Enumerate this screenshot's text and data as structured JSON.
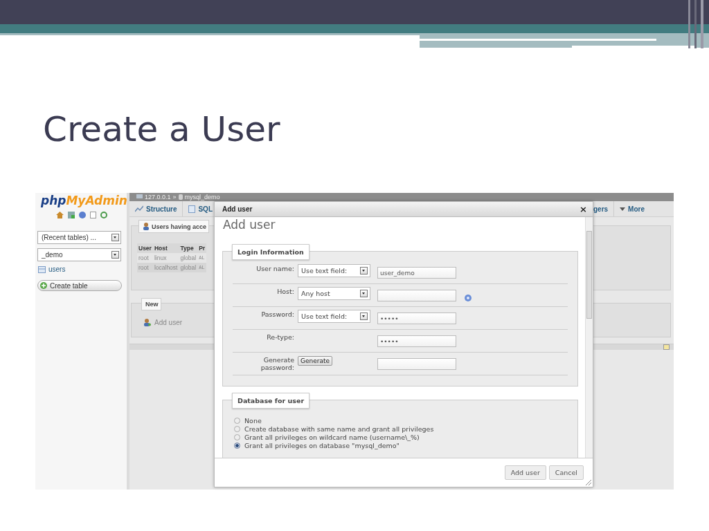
{
  "slide": {
    "title": "Create a User"
  },
  "sidebar": {
    "logo": {
      "first": "php",
      "second": "MyAdmin"
    },
    "recent_tables": "(Recent tables) ...",
    "database": "_demo",
    "tables": [
      {
        "name": "users"
      }
    ],
    "create_button": "Create table"
  },
  "breadcrumb": {
    "server": "127.0.0.1",
    "separator": "»",
    "database": "mysql_demo"
  },
  "tabs_left": [
    {
      "label": "Structure"
    },
    {
      "label": "SQL"
    }
  ],
  "tabs_right": [
    {
      "label": "gers"
    },
    {
      "label": "More"
    }
  ],
  "users_panel": {
    "legend": "Users having acce",
    "columns": [
      "User",
      "Host",
      "Type",
      "Pr"
    ],
    "rows": [
      [
        "root",
        "linux",
        "global",
        "AL"
      ],
      [
        "root",
        "localhost",
        "global",
        "AL"
      ]
    ]
  },
  "new_panel": {
    "legend": "New",
    "link": "Add user"
  },
  "dialog": {
    "title": "Add user",
    "close": "×",
    "heading": "Add user",
    "login": {
      "legend": "Login Information",
      "rows": [
        {
          "label": "User name:",
          "kind": "select",
          "select": "Use text field:",
          "value": "user_demo",
          "help": false
        },
        {
          "label": "Host:",
          "kind": "select",
          "select": "Any host",
          "value": "",
          "help": true
        },
        {
          "label": "Password:",
          "kind": "select",
          "select": "Use text field:",
          "value": "•••••",
          "help": false
        },
        {
          "label": "Re-type:",
          "kind": "plain",
          "value": "•••••",
          "help": false
        },
        {
          "label": "Generate password:",
          "kind": "button",
          "button": "Generate",
          "value": "",
          "help": false
        }
      ]
    },
    "database": {
      "legend": "Database for user",
      "options": [
        {
          "label": "None",
          "selected": false
        },
        {
          "label": "Create database with same name and grant all privileges",
          "selected": false
        },
        {
          "label": "Grant all privileges on wildcard name (username\\_%)",
          "selected": false
        },
        {
          "label": "Grant all privileges on database \"mysql_demo\"",
          "selected": true
        }
      ]
    },
    "buttons": [
      "Add user",
      "Cancel"
    ]
  }
}
